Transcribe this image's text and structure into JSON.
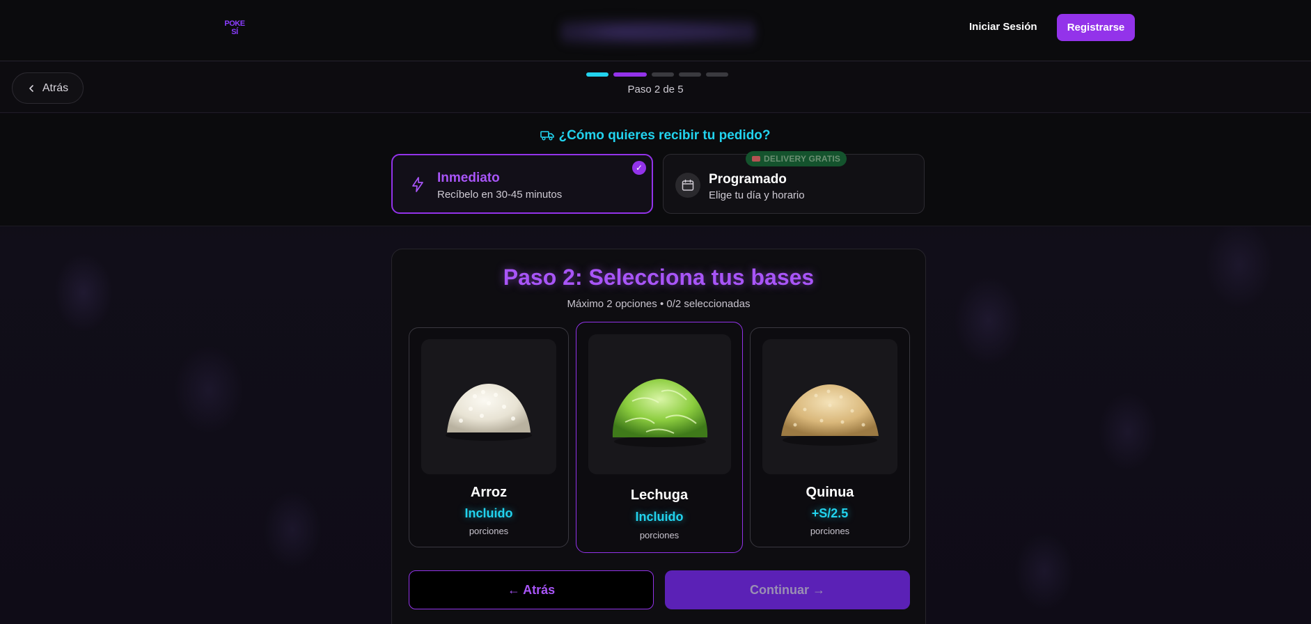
{
  "header": {
    "logo_line1": "POKE",
    "logo_line2": "SÍ",
    "login_label": "Iniciar Sesión",
    "register_label": "Registrarse"
  },
  "stepper": {
    "back_label": "Atrás",
    "step_label": "Paso 2 de 5",
    "current_step": 2,
    "total_steps": 5
  },
  "delivery": {
    "title": "¿Cómo quieres recibir tu pedido?",
    "options": [
      {
        "title": "Inmediato",
        "subtitle": "Recíbelo en 30-45 minutos",
        "icon": "lightning-icon",
        "selected": true
      },
      {
        "title": "Programado",
        "subtitle": "Elige tu día y horario",
        "icon": "calendar-icon",
        "selected": false,
        "badge": "DELIVERY GRATIS"
      }
    ],
    "check_mark": "✓"
  },
  "main": {
    "title": "Paso 2: Selecciona tus bases",
    "subtitle": "Máximo 2 opciones • 0/2 seleccionadas",
    "bases": [
      {
        "name": "Arroz",
        "price": "Incluido",
        "unit": "porciones",
        "image": "rice-image"
      },
      {
        "name": "Lechuga",
        "price": "Incluido",
        "unit": "porciones",
        "image": "lettuce-image"
      },
      {
        "name": "Quinua",
        "price": "+S/2.5",
        "unit": "porciones",
        "image": "quinoa-image"
      }
    ],
    "back_button": "← Atrás",
    "continue_button": "Continuar →"
  },
  "colors": {
    "accent_purple": "#9333ea",
    "accent_cyan": "#22d3ee",
    "background": "#0b0a0f"
  }
}
